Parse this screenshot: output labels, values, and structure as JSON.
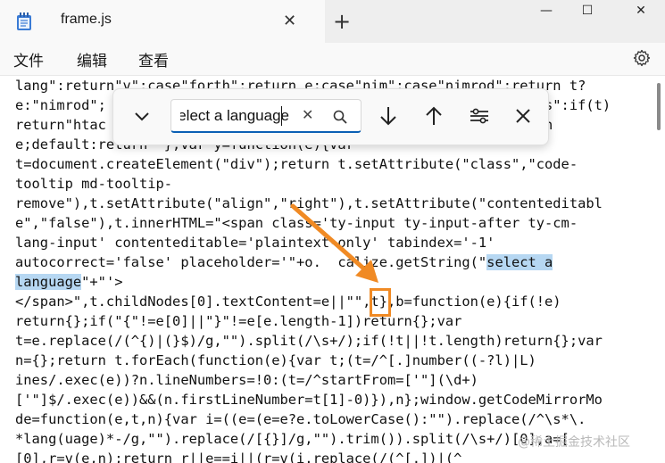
{
  "window": {
    "tab_title": "frame.js",
    "close_tab_glyph": "✕",
    "new_tab_glyph": "+",
    "minimize_glyph": "—",
    "maximize_glyph": "☐",
    "close_glyph": "✕"
  },
  "menu": {
    "file": "文件",
    "edit": "编辑",
    "view": "查看"
  },
  "find": {
    "value": "select a language",
    "clear_glyph": "✕"
  },
  "code": {
    "lines": [
      "lang\":return\"v\":case\"forth\":return e;case\"nim\":case\"nimrod\":return t?",
      "e:\"nimrod\";                                                  cess\":if(t)",
      "return\"htac                                                   urn",
      "e;default:return  };var y=function(e){var",
      "t=document.createElement(\"div\");return t.setAttribute(\"class\",\"code-",
      "tooltip md-tooltip-",
      "remove\"),t.setAttribute(\"align\",\"right\"),t.setAttribute(\"contenteditabl",
      "e\",\"false\"),t.innerHTML=\"<span class='ty-input ty-input-after ty-cm-",
      "lang-input' contenteditable='plaintext-only' tabindex='-1'",
      "autocorrect='false' placeholder='\"+o.  calize.getString(\"",
      "",
      "</span>\",t.childNodes[0].textContent=e||\"\",t},b=function(e){if(!e)",
      "return{};if(\"{\"!=e[0]||\"}\"!=e[e.length-1])return{};var",
      "t=e.replace(/(^{)|(}$)/g,\"\").split(/\\s+/);if(!t||!t.length)return{};var",
      "n={};return t.forEach(function(e){var t;(t=/^[.]number((-?l)|L)",
      "ines/.exec(e))?n.lineNumbers=!0:(t=/^startFrom=['\"](\\d+)",
      "['\"]$/.exec(e))&&(n.firstLineNumber=t[1]-0)}),n};window.getCodeMirrorMo",
      "de=function(e,t,n){var i=((e=(e=e?e.toLowerCase():\"\").replace(/^\\s*\\.",
      "*lang(uage)*-/g,\"\").replace(/[{}]/g,\"\").trim()).split(/\\s+/)[0],a=[",
      "[0],r=v(e,n);return r||e==i||(r=v(i.replace(/(^[.])|(^",
      "\"\"\"\")===\"\"\"\"\"\"\"\"\"\"\"\"\"\"\"\"\"\"\"\"\"\"\"\"\"\"\"\"\""
    ],
    "match_part1": "select a",
    "match_part2": "language",
    "after_match": "\"+\"'>"
  },
  "watermark": "@稀土掘金技术社区",
  "colors": {
    "selection": "#b6d7f2",
    "accent": "#0a5fb4",
    "annotation": "#f08a24"
  },
  "icons": [
    "notepad-icon",
    "close-icon",
    "plus-icon",
    "minimize-icon",
    "maximize-icon",
    "settings-icon",
    "chevron-down-icon",
    "search-icon",
    "arrow-down-icon",
    "arrow-up-icon",
    "options-icon"
  ]
}
